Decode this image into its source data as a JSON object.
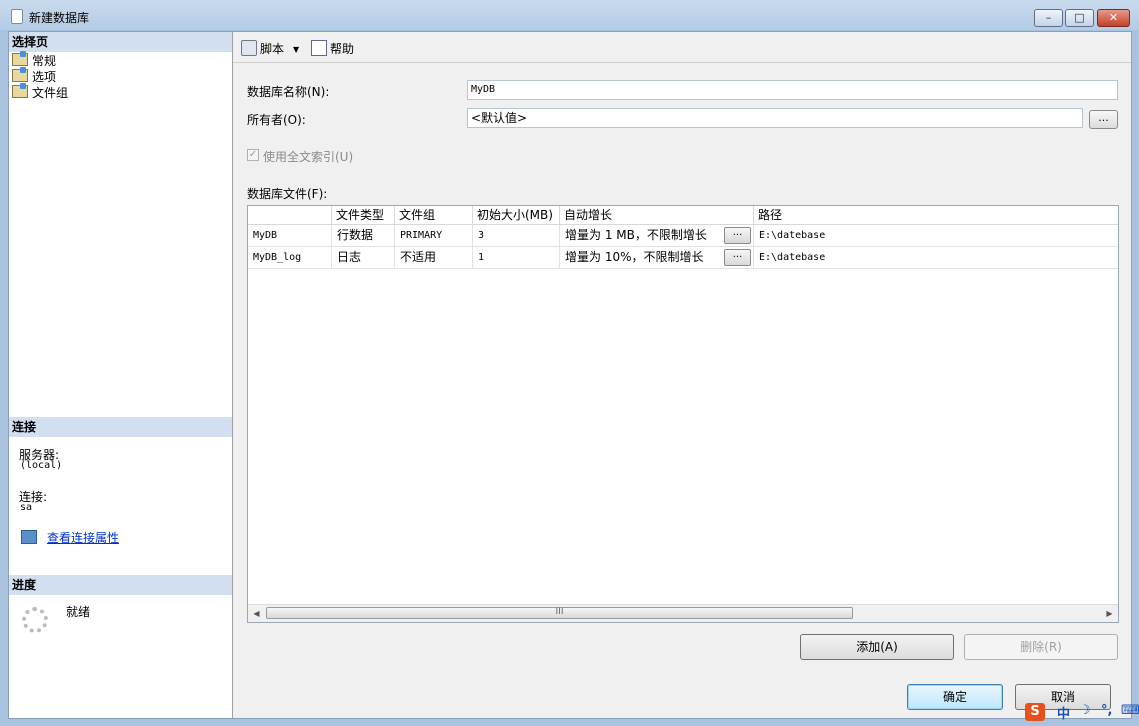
{
  "window": {
    "title": "新建数据库",
    "buttons": {
      "minimize": "–",
      "maximize": "□",
      "close": "✕"
    }
  },
  "left": {
    "select_page_header": "选择页",
    "pages": [
      {
        "label": "常规"
      },
      {
        "label": "选项"
      },
      {
        "label": "文件组"
      }
    ],
    "connection_header": "连接",
    "server_label": "服务器:",
    "server_value": "(local)",
    "connection_label": "连接:",
    "connection_value": "sa",
    "view_link": "查看连接属性",
    "progress_header": "进度",
    "progress_status": "就绪"
  },
  "toolbar": {
    "script_label": "脚本",
    "help_label": "帮助"
  },
  "form": {
    "db_name_label": "数据库名称(N):",
    "db_name_value": "MyDB",
    "owner_label": "所有者(O):",
    "owner_value": "<默认值>",
    "ellipsis": "...",
    "fulltext_label": "使用全文索引(U)",
    "fulltext_checked": true,
    "files_label": "数据库文件(F):"
  },
  "grid": {
    "columns": [
      "",
      "文件类型",
      "文件组",
      "初始大小(MB)",
      "自动增长",
      "路径"
    ],
    "rows": [
      {
        "name": "MyDB",
        "type": "行数据",
        "filegroup": "PRIMARY",
        "size": "3",
        "growth": "增量为 1 MB，不限制增长",
        "path": "E:\\datebase"
      },
      {
        "name": "MyDB_log",
        "type": "日志",
        "filegroup": "不适用",
        "size": "1",
        "growth": "增量为 10%，不限制增长",
        "path": "E:\\datebase"
      }
    ],
    "scroll_grip": "III"
  },
  "buttons": {
    "add": "添加(A)",
    "remove": "删除(R)",
    "ok": "确定",
    "cancel": "取消"
  },
  "tray": {
    "sogou": "S",
    "lang": "中",
    "moon": "☽",
    "punct": "°,",
    "keyboard": "⌨"
  },
  "colors": {
    "title_bar": "#b4cce6",
    "section_header": "#d2dff0",
    "link": "#0033cc",
    "sogou_brand": "#e8501c"
  }
}
